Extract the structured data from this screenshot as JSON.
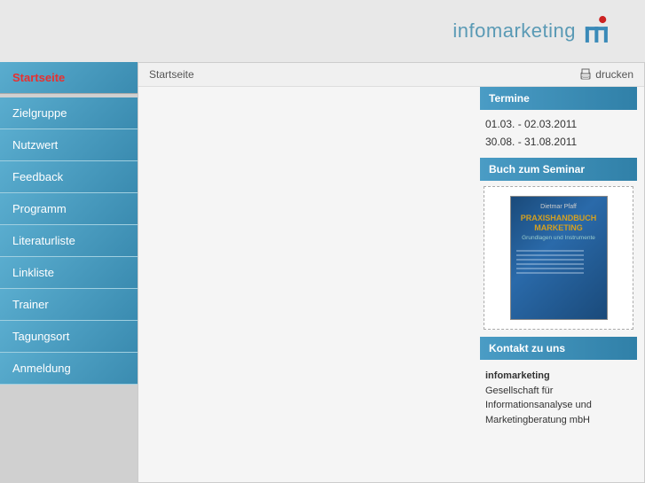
{
  "header": {
    "logo_text": "infomarketing",
    "logo_icon_alt": "im logo"
  },
  "breadcrumb": {
    "current": "Startseite",
    "print_label": "drucken"
  },
  "sidebar": {
    "items": [
      {
        "label": "Startseite",
        "active": true
      },
      {
        "label": "Zielgruppe",
        "active": false
      },
      {
        "label": "Nutzwert",
        "active": false
      },
      {
        "label": "Feedback",
        "active": false
      },
      {
        "label": "Programm",
        "active": false
      },
      {
        "label": "Literaturliste",
        "active": false
      },
      {
        "label": "Linkliste",
        "active": false
      },
      {
        "label": "Trainer",
        "active": false
      },
      {
        "label": "Tagungsort",
        "active": false
      },
      {
        "label": "Anmeldung",
        "active": false
      }
    ]
  },
  "right_panel": {
    "termine_header": "Termine",
    "termine_items": [
      "01.03. - 02.03.2011",
      "30.08. - 31.08.2011"
    ],
    "buch_header": "Buch zum Seminar",
    "book_author": "Dietmar Pfaff",
    "book_title": "PRAXISHANDBUCH MARKETING",
    "book_subtitle": "Grundlagen und Instrumente",
    "kontakt_header": "Kontakt zu uns",
    "kontakt_name": "infomarketing",
    "kontakt_line1": "Gesellschaft für",
    "kontakt_line2": "Informationsanalyse und",
    "kontakt_line3": "Marketingberatung mbH"
  },
  "colors": {
    "sidebar_bg": "#4a9cc5",
    "active_text": "#e83030",
    "header_bg": "#3080a8"
  }
}
